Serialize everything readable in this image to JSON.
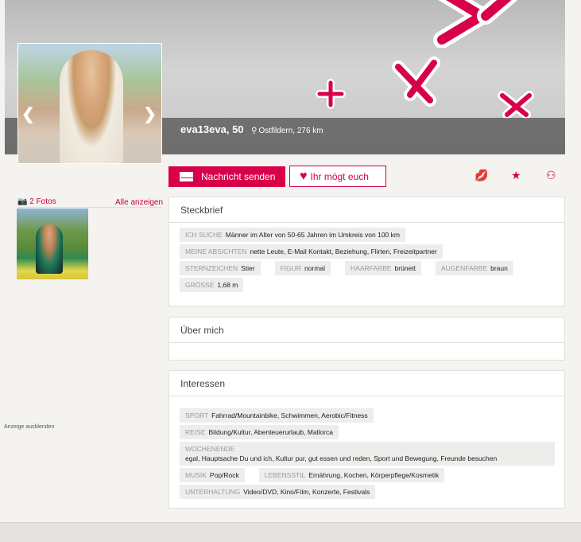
{
  "profile": {
    "name_age": "eva13eva, 50",
    "location": "Ostfildern, 276 km"
  },
  "photos": {
    "count_label": "2 Fotos",
    "show_all": "Alle anzeigen"
  },
  "actions": {
    "message": "Nachricht senden",
    "like": "Ihr mögt euch"
  },
  "ad": {
    "hide": "Anzeige ausblenden"
  },
  "steckbrief": {
    "title": "Steckbrief",
    "rows": [
      [
        {
          "k": "Ich suche",
          "v": "Männer im Alter von 50-65 Jahren im Umkreis von 100 km"
        }
      ],
      [
        {
          "k": "Meine Absichten",
          "v": "nette Leute, E-Mail Kontakt, Beziehung, Flirten, Freizeitpartner"
        }
      ],
      [
        {
          "k": "Sternzeichen",
          "v": "Stier"
        },
        {
          "k": "Figur",
          "v": "normal"
        },
        {
          "k": "Haarfarbe",
          "v": "brünett"
        },
        {
          "k": "Augenfarbe",
          "v": "braun"
        }
      ],
      [
        {
          "k": "Grösse",
          "v": "1,68 m"
        }
      ]
    ]
  },
  "ueber": {
    "title": "Über mich"
  },
  "interessen": {
    "title": "Interessen",
    "sport": {
      "k": "Sport",
      "v": "Fahrrad/Mountainbike, Schwimmen, Aerobic/Fitness"
    },
    "reise": {
      "k": "Reise",
      "v": "Bildung/Kultur, Abenteuerurlaub, Mallorca"
    },
    "wochenende": {
      "k": "Wochenende",
      "v": "egal, Hauptsache Du und ich, Kultur pur, gut essen und reden, Sport und Bewegung, Freunde besuchen"
    },
    "musik": {
      "k": "Musik",
      "v": "Pop/Rock"
    },
    "lebensstil": {
      "k": "Lebensstil",
      "v": "Ernährung, Kochen, Körperpflege/Kosmetik"
    },
    "unterhaltung": {
      "k": "Unterhaltung",
      "v": "Video/DVD, Kino/Film, Konzerte, Festivals"
    }
  }
}
